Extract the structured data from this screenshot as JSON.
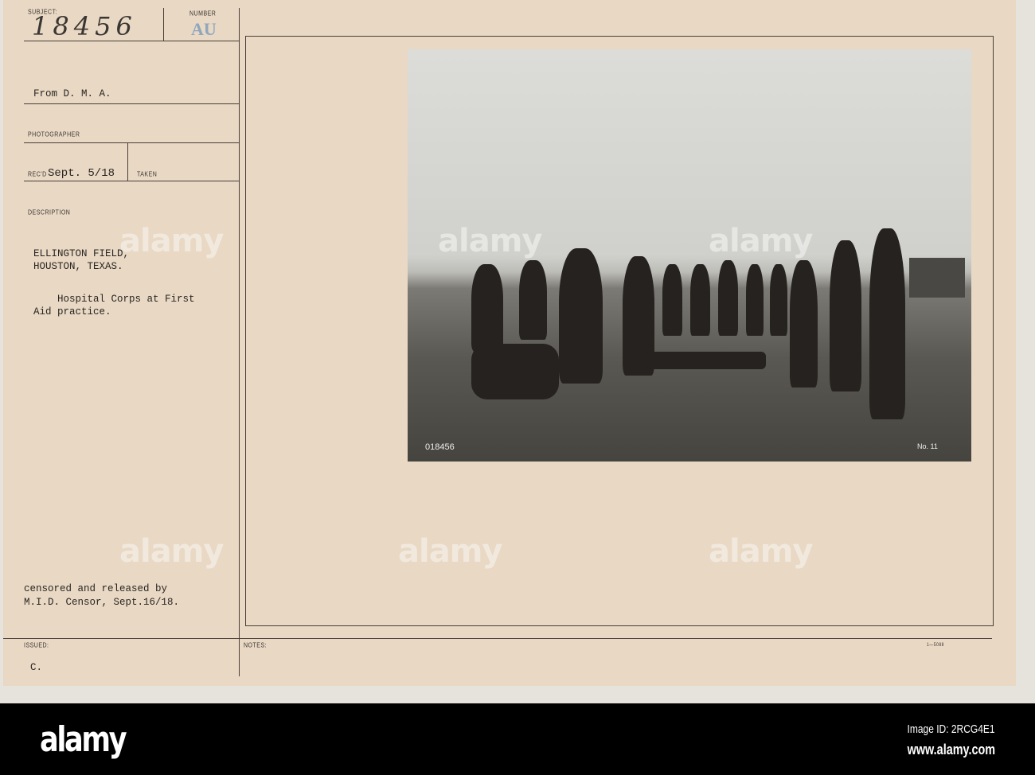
{
  "card": {
    "subject_label": "SUBJECT:",
    "subject_number": "18456",
    "number_label": "NUMBER",
    "number_stamp": "AU",
    "from": "From D. M. A.",
    "photographer_label": "PHOTOGRAPHER",
    "recd_label": "REC'D",
    "recd_value": "Sept. 5/18",
    "taken_label": "TAKEN",
    "description_label": "DESCRIPTION",
    "description_lines": [
      "ELLINGTON FIELD,",
      "HOUSTON, TEXAS.",
      "    Hospital Corps at First",
      "Aid practice."
    ],
    "censor_lines": [
      "censored and released by",
      "M.I.D. Censor, Sept.16/18."
    ],
    "issued_label": "ISSUED:",
    "issued_value": "C.",
    "notes_label": "NOTES:",
    "form_code": "1—5088"
  },
  "photo": {
    "negative_number": "018456",
    "plate_label": "No. 11"
  },
  "watermark": "alamy",
  "banner": {
    "logo": "alamy",
    "image_id": "Image ID: 2RCG4E1",
    "url": "www.alamy.com"
  }
}
